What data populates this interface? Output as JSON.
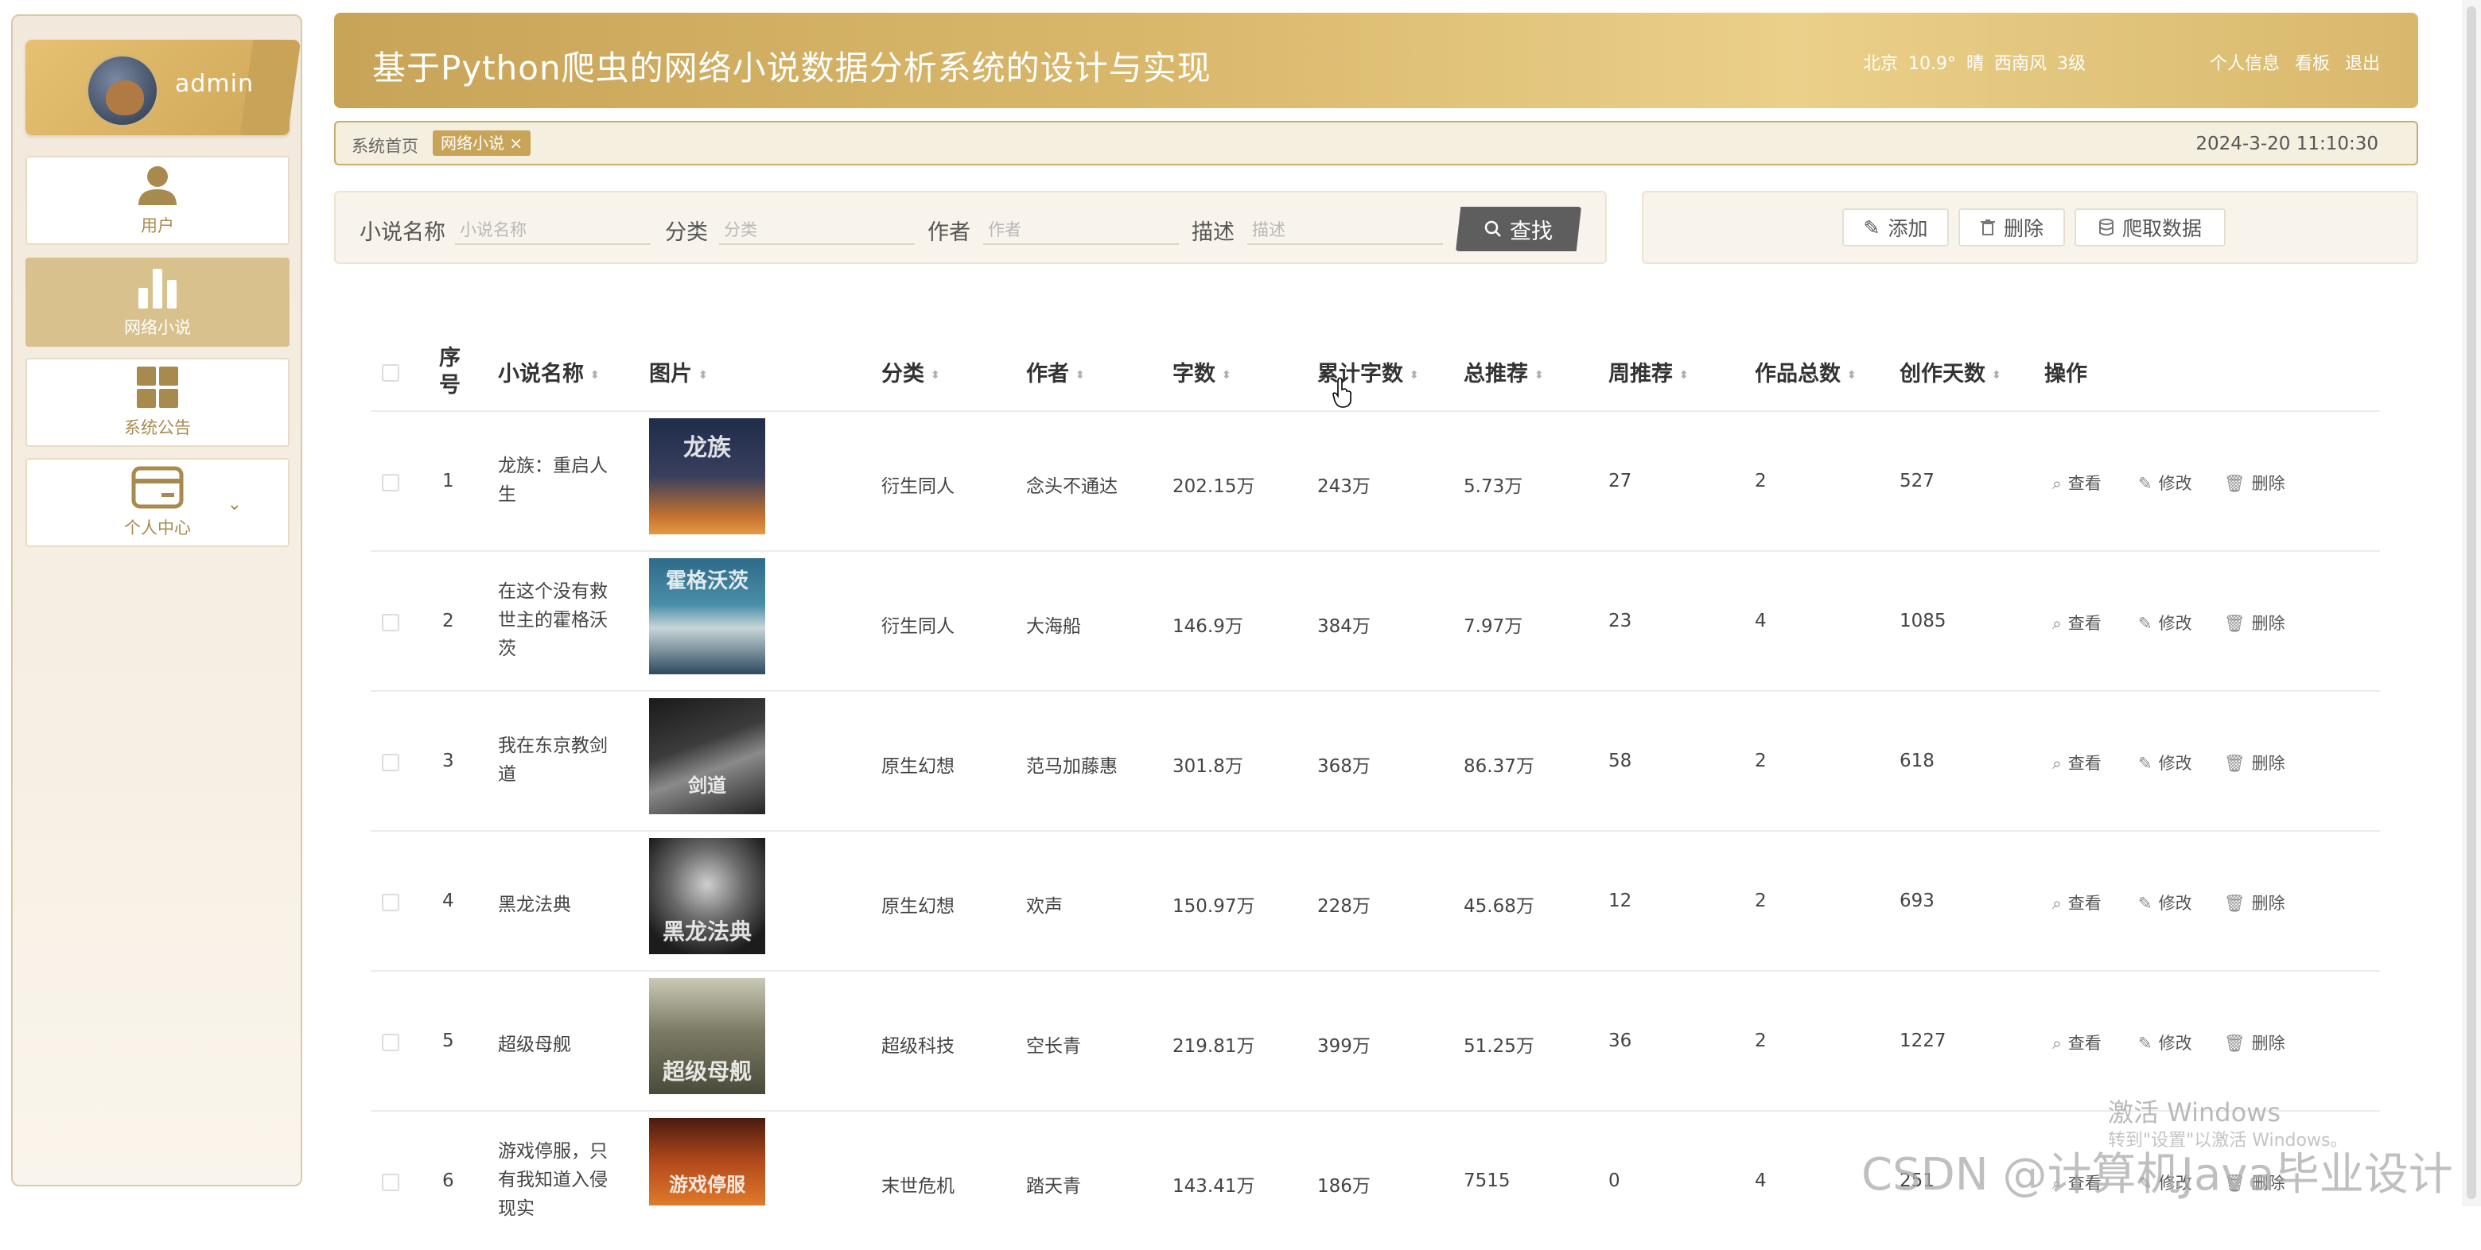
{
  "sidebar": {
    "username": "admin",
    "items": [
      {
        "label": "用户",
        "icon": "user-icon"
      },
      {
        "label": "网络小说",
        "icon": "bar-chart-icon"
      },
      {
        "label": "系统公告",
        "icon": "grid-icon"
      },
      {
        "label": "个人中心",
        "icon": "card-icon"
      }
    ]
  },
  "header": {
    "title": "基于Python爬虫的网络小说数据分析系统的设计与实现",
    "weather": "北京 10.9° 晴 西南风 3级",
    "links": [
      "个人信息",
      "看板",
      "退出"
    ]
  },
  "breadcrumb": {
    "home": "系统首页",
    "tag": "网络小说 ×",
    "datetime": "2024-3-20 11:10:30"
  },
  "search": {
    "fields": [
      {
        "label": "小说名称",
        "placeholder": "小说名称"
      },
      {
        "label": "分类",
        "placeholder": "分类"
      },
      {
        "label": "作者",
        "placeholder": "作者"
      },
      {
        "label": "描述",
        "placeholder": "描述"
      }
    ],
    "button": "查找"
  },
  "actions": {
    "add": "添加",
    "delete": "删除",
    "crawl": "爬取数据"
  },
  "table": {
    "headers": [
      "序号",
      "小说名称",
      "图片",
      "分类",
      "作者",
      "字数",
      "累计字数",
      "总推荐",
      "周推荐",
      "作品总数",
      "创作天数",
      "操作"
    ],
    "ops": [
      "查看",
      "修改",
      "删除"
    ],
    "rows": [
      {
        "index": "1",
        "name": "龙族：重启人生",
        "cover_text": "龙族",
        "category": "衍生同人",
        "author": "念头不通达",
        "words": "202.15万",
        "total_words": "243万",
        "total_rec": "5.73万",
        "week_rec": "27",
        "works": "2",
        "days": "527"
      },
      {
        "index": "2",
        "name": "在这个没有救世主的霍格沃茨",
        "cover_text": "霍格沃茨",
        "category": "衍生同人",
        "author": "大海船",
        "words": "146.9万",
        "total_words": "384万",
        "total_rec": "7.97万",
        "week_rec": "23",
        "works": "4",
        "days": "1085"
      },
      {
        "index": "3",
        "name": "我在东京教剑道",
        "cover_text": "剑道",
        "category": "原生幻想",
        "author": "范马加藤惠",
        "words": "301.8万",
        "total_words": "368万",
        "total_rec": "86.37万",
        "week_rec": "58",
        "works": "2",
        "days": "618"
      },
      {
        "index": "4",
        "name": "黑龙法典",
        "cover_text": "黑龙法典",
        "category": "原生幻想",
        "author": "欢声",
        "words": "150.97万",
        "total_words": "228万",
        "total_rec": "45.68万",
        "week_rec": "12",
        "works": "2",
        "days": "693"
      },
      {
        "index": "5",
        "name": "超级母舰",
        "cover_text": "超级母舰",
        "category": "超级科技",
        "author": "空长青",
        "words": "219.81万",
        "total_words": "399万",
        "total_rec": "51.25万",
        "week_rec": "36",
        "works": "2",
        "days": "1227"
      },
      {
        "index": "6",
        "name": "游戏停服，只有我知道入侵现实",
        "cover_text": "游戏停服",
        "category": "末世危机",
        "author": "踏天青",
        "words": "143.41万",
        "total_words": "186万",
        "total_rec": "7515",
        "week_rec": "0",
        "works": "4",
        "days": "251"
      }
    ]
  },
  "overlay": {
    "activate": "激活 Windows",
    "activate_sub": "转到\"设置\"以激活 Windows。",
    "csdn": "CSDN @计算机Java毕业设计"
  },
  "colors": {
    "accent": "#c8a458",
    "active_menu": "#d8c18c",
    "search_button": "#5e5e5e"
  }
}
